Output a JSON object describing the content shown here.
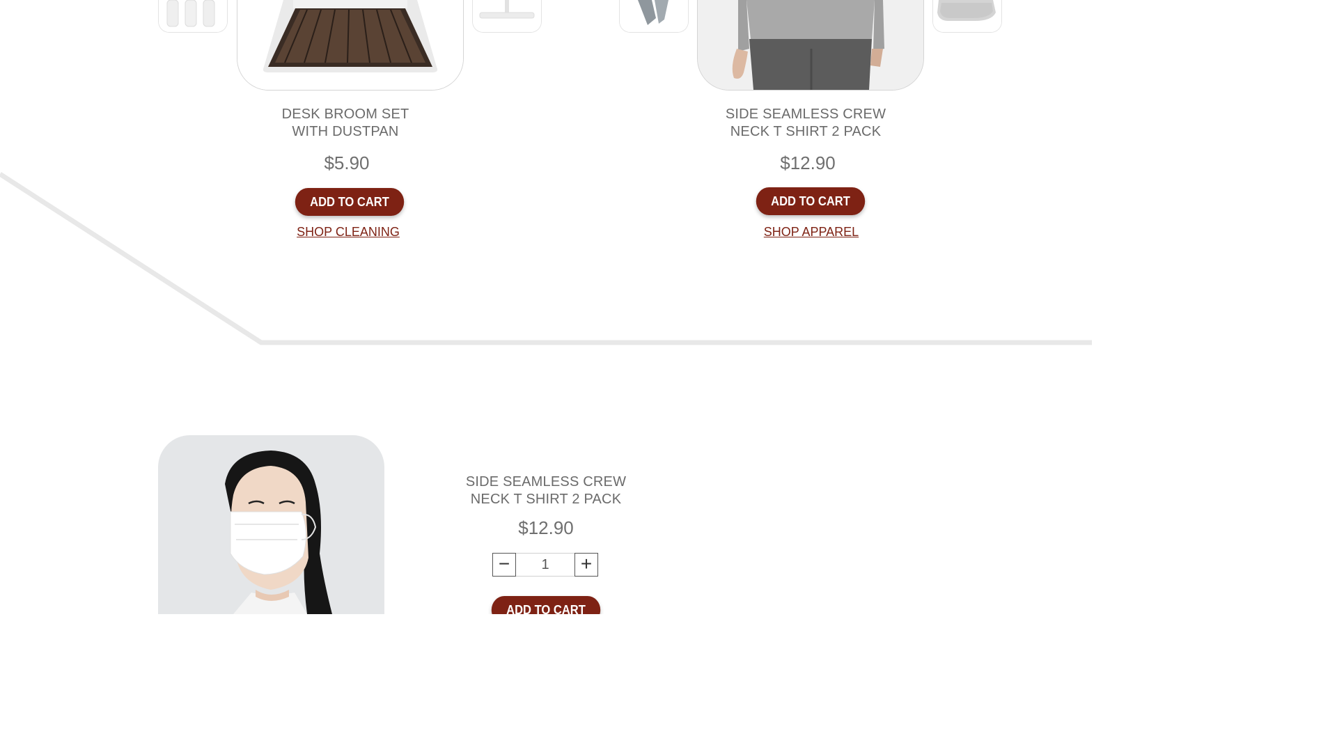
{
  "colors": {
    "accent": "#7e2214",
    "text": "#6a6a6a",
    "divider": "#e8e8e8"
  },
  "products": [
    {
      "title": "DESK BROOM SET\nWITH DUSTPAN",
      "price": "$5.90",
      "add_to_cart": "ADD TO CART",
      "shop_link": "SHOP CLEANING"
    },
    {
      "title": "SIDE SEAMLESS CREW\nNECK T SHIRT 2 PACK",
      "price": "$12.90",
      "add_to_cart": "ADD TO CART",
      "shop_link": "SHOP APPAREL"
    }
  ],
  "featured": {
    "title": "SIDE SEAMLESS CREW\nNECK T SHIRT 2 PACK",
    "price": "$12.90",
    "quantity": "1",
    "minus": "−",
    "plus": "+",
    "add_to_cart": "ADD TO CART"
  },
  "icons": {
    "minus": "minus-icon",
    "plus": "plus-icon"
  }
}
